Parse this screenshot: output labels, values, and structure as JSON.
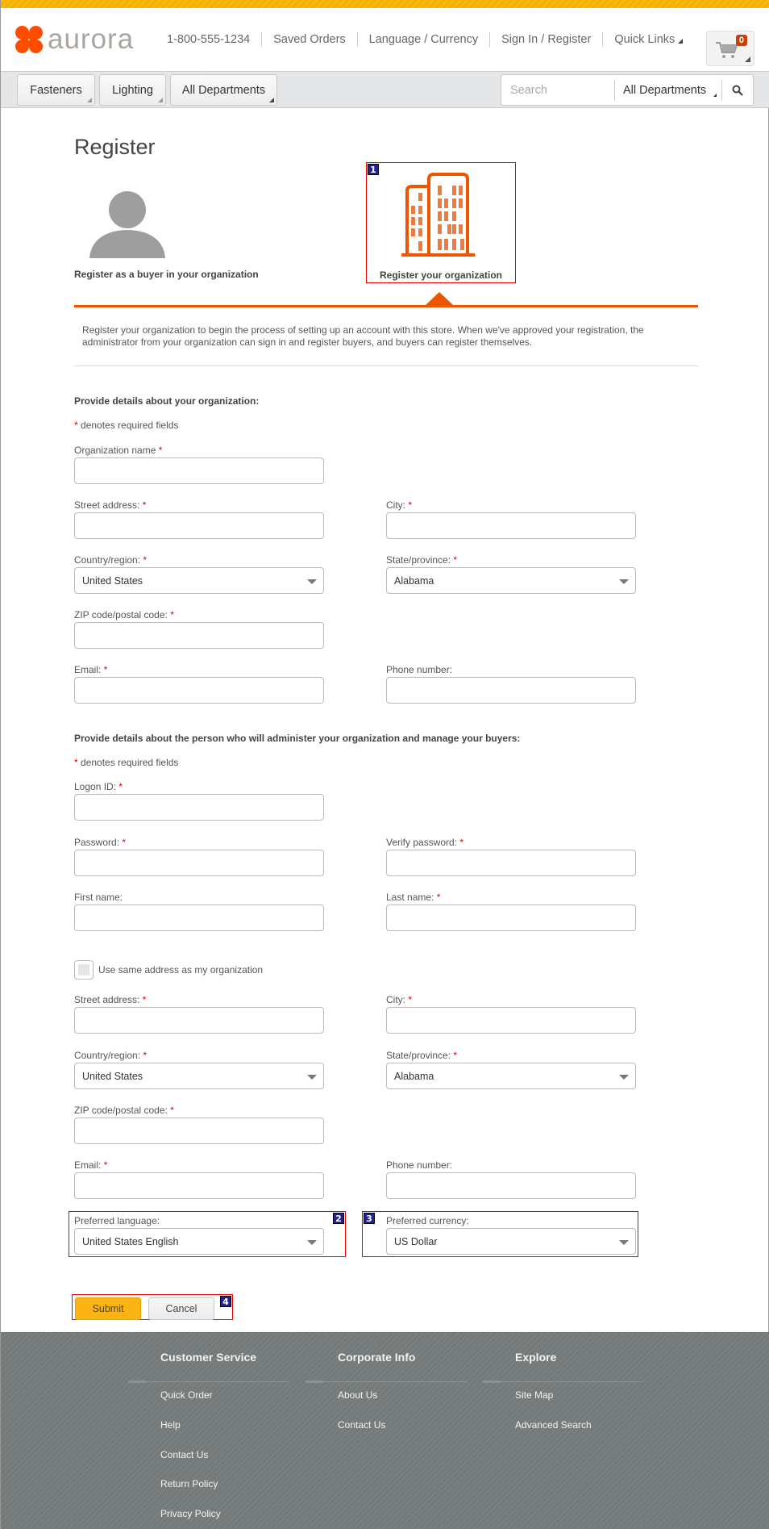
{
  "header": {
    "logo_text": "aurora",
    "phone": "1-800-555-1234",
    "links": [
      "Saved Orders",
      "Language / Currency",
      "Sign In / Register",
      "Quick Links"
    ],
    "cart_count": "0",
    "brand_color": "#ff4d00"
  },
  "navbar": {
    "departments": [
      "Fasteners",
      "Lighting",
      "All Departments"
    ],
    "search_placeholder": "Search",
    "search_department": "All Departments"
  },
  "page": {
    "title": "Register",
    "option_buyer_label": "Register as a buyer in your organization",
    "option_org_label": "Register your organization",
    "intro": "Register your organization to begin the process of setting up an account with this store. When we've approved your registration, the administrator from your organization can sign in and register buyers, and buyers can register themselves.",
    "accent_color": "#ee5500"
  },
  "org_section": {
    "heading": "Provide details about your organization:",
    "required_note": "denotes required fields",
    "fields": {
      "org_name": {
        "label": "Organization name",
        "required": true,
        "value": ""
      },
      "street": {
        "label": "Street address:",
        "required": true,
        "value": ""
      },
      "city": {
        "label": "City:",
        "required": true,
        "value": ""
      },
      "country": {
        "label": "Country/region:",
        "required": true,
        "value": "United States"
      },
      "state": {
        "label": "State/province:",
        "required": true,
        "value": "Alabama"
      },
      "zip": {
        "label": "ZIP code/postal code:",
        "required": true,
        "value": ""
      },
      "email": {
        "label": "Email:",
        "required": true,
        "value": ""
      },
      "phone": {
        "label": "Phone number:",
        "required": false,
        "value": ""
      }
    }
  },
  "admin_section": {
    "heading": "Provide details about the person who will administer your organization and manage your buyers:",
    "required_note": "denotes required fields",
    "same_address_label": "Use same address as my organization",
    "same_address_checked": false,
    "fields": {
      "logon_id": {
        "label": "Logon ID:",
        "required": true,
        "value": ""
      },
      "password": {
        "label": "Password:",
        "required": true,
        "value": ""
      },
      "verify_password": {
        "label": "Verify password:",
        "required": true,
        "value": ""
      },
      "first_name": {
        "label": "First name:",
        "required": false,
        "value": ""
      },
      "last_name": {
        "label": "Last name:",
        "required": true,
        "value": ""
      },
      "street": {
        "label": "Street address:",
        "required": true,
        "value": ""
      },
      "city": {
        "label": "City:",
        "required": true,
        "value": ""
      },
      "country": {
        "label": "Country/region:",
        "required": true,
        "value": "United States"
      },
      "state": {
        "label": "State/province:",
        "required": true,
        "value": "Alabama"
      },
      "zip": {
        "label": "ZIP code/postal code:",
        "required": true,
        "value": ""
      },
      "email": {
        "label": "Email:",
        "required": true,
        "value": ""
      },
      "phone": {
        "label": "Phone number:",
        "required": false,
        "value": ""
      },
      "language": {
        "label": "Preferred language:",
        "required": false,
        "value": "United States English"
      },
      "currency": {
        "label": "Preferred currency:",
        "required": false,
        "value": "US Dollar"
      }
    }
  },
  "actions": {
    "submit": "Submit",
    "cancel": "Cancel"
  },
  "annotations": [
    "1",
    "2",
    "3",
    "4"
  ],
  "footer": {
    "columns": [
      {
        "heading": "Customer Service",
        "links": [
          "Quick Order",
          "Help",
          "Contact Us",
          "Return Policy",
          "Privacy Policy"
        ]
      },
      {
        "heading": "Corporate Info",
        "links": [
          "About Us",
          "Contact Us"
        ]
      },
      {
        "heading": "Explore",
        "links": [
          "Site Map",
          "Advanced Search"
        ]
      }
    ]
  }
}
